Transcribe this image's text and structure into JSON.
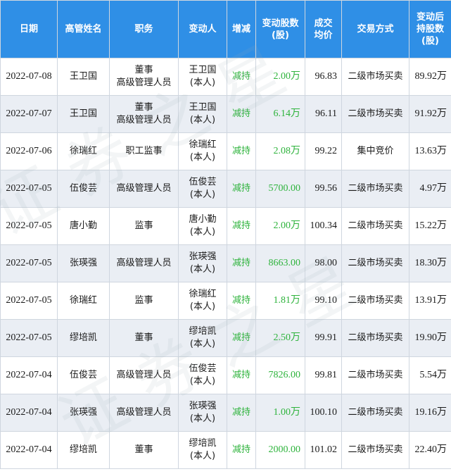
{
  "header": {
    "date": "日期",
    "name": "高管姓名",
    "position": "职务",
    "changer": "变动人",
    "trend": "增减",
    "shares_line1": "变动股数",
    "shares_line2": "(股)",
    "price_line1": "成交",
    "price_line2": "均价",
    "method": "交易方式",
    "after_line1": "变动后",
    "after_line2": "持股数",
    "after_line3": "(股)"
  },
  "rows": [
    {
      "date": "2022-07-08",
      "name": "王卫国",
      "position_line1": "董事",
      "position_line2": "高级管理人员",
      "changer_line1": "王卫国",
      "changer_line2": "(本人)",
      "trend": "减持",
      "shares": "2.00万",
      "price": "96.83",
      "method": "二级市场买卖",
      "after": "89.92万"
    },
    {
      "date": "2022-07-07",
      "name": "王卫国",
      "position_line1": "董事",
      "position_line2": "高级管理人员",
      "changer_line1": "王卫国",
      "changer_line2": "(本人)",
      "trend": "减持",
      "shares": "6.14万",
      "price": "96.11",
      "method": "二级市场买卖",
      "after": "91.92万"
    },
    {
      "date": "2022-07-06",
      "name": "徐瑞红",
      "position_line1": "职工监事",
      "position_line2": "",
      "changer_line1": "徐瑞红",
      "changer_line2": "(本人)",
      "trend": "减持",
      "shares": "2.08万",
      "price": "99.22",
      "method": "集中竞价",
      "after": "13.63万"
    },
    {
      "date": "2022-07-05",
      "name": "伍俊芸",
      "position_line1": "高级管理人员",
      "position_line2": "",
      "changer_line1": "伍俊芸",
      "changer_line2": "(本人)",
      "trend": "减持",
      "shares": "5700.00",
      "price": "99.56",
      "method": "二级市场买卖",
      "after": "4.97万"
    },
    {
      "date": "2022-07-05",
      "name": "唐小勤",
      "position_line1": "监事",
      "position_line2": "",
      "changer_line1": "唐小勤",
      "changer_line2": "(本人)",
      "trend": "减持",
      "shares": "2.00万",
      "price": "100.34",
      "method": "二级市场买卖",
      "after": "15.22万"
    },
    {
      "date": "2022-07-05",
      "name": "张瑛强",
      "position_line1": "高级管理人员",
      "position_line2": "",
      "changer_line1": "张瑛强",
      "changer_line2": "(本人)",
      "trend": "减持",
      "shares": "8663.00",
      "price": "98.00",
      "method": "二级市场买卖",
      "after": "18.30万"
    },
    {
      "date": "2022-07-05",
      "name": "徐瑞红",
      "position_line1": "监事",
      "position_line2": "",
      "changer_line1": "徐瑞红",
      "changer_line2": "(本人)",
      "trend": "减持",
      "shares": "1.81万",
      "price": "99.10",
      "method": "二级市场买卖",
      "after": "13.91万"
    },
    {
      "date": "2022-07-05",
      "name": "缪培凯",
      "position_line1": "董事",
      "position_line2": "",
      "changer_line1": "缪培凯",
      "changer_line2": "(本人)",
      "trend": "减持",
      "shares": "2.50万",
      "price": "99.91",
      "method": "二级市场买卖",
      "after": "19.90万"
    },
    {
      "date": "2022-07-04",
      "name": "伍俊芸",
      "position_line1": "高级管理人员",
      "position_line2": "",
      "changer_line1": "伍俊芸",
      "changer_line2": "(本人)",
      "trend": "减持",
      "shares": "7826.00",
      "price": "99.81",
      "method": "二级市场买卖",
      "after": "5.54万"
    },
    {
      "date": "2022-07-04",
      "name": "张瑛强",
      "position_line1": "高级管理人员",
      "position_line2": "",
      "changer_line1": "张瑛强",
      "changer_line2": "(本人)",
      "trend": "减持",
      "shares": "1.00万",
      "price": "100.10",
      "method": "二级市场买卖",
      "after": "19.16万"
    },
    {
      "date": "2022-07-04",
      "name": "缪培凯",
      "position_line1": "董事",
      "position_line2": "",
      "changer_line1": "缪培凯",
      "changer_line2": "(本人)",
      "trend": "减持",
      "shares": "2000.00",
      "price": "101.02",
      "method": "二级市场买卖",
      "after": "22.40万"
    }
  ],
  "watermark": "证券之星",
  "colors": {
    "header_bg": "#2f8fe6",
    "stripe": "#eaeef4",
    "green": "#2eb33c"
  }
}
